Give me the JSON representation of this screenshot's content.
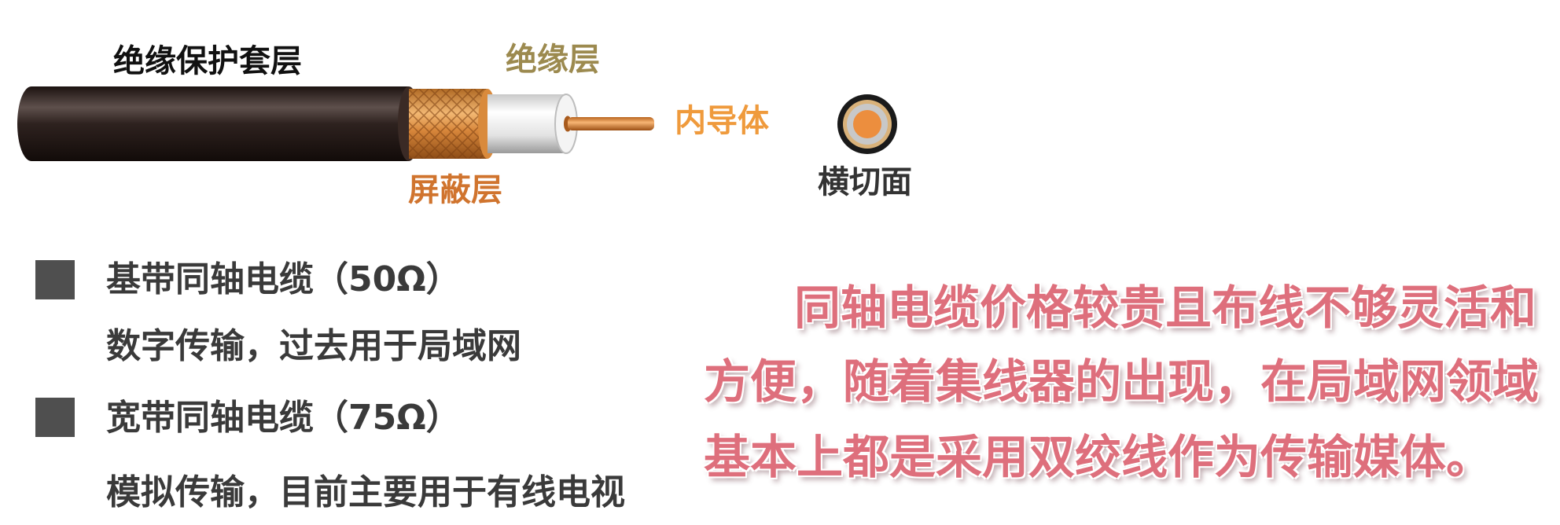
{
  "diagram": {
    "labels": {
      "jacket": "绝缘保护套层",
      "insulation": "绝缘层",
      "conductor": "内导体",
      "shield": "屏蔽层",
      "cross_section": "横切面"
    },
    "colors": {
      "jacket": "#2b1d19",
      "insulation_label": "#9c8a4f",
      "conductor_label": "#ef9a3c",
      "shield_label": "#d0742e",
      "cross_section_label": "#333333"
    }
  },
  "list": {
    "items": [
      {
        "title": "基带同轴电缆（50Ω）",
        "desc": "数字传输，过去用于局域网"
      },
      {
        "title": "宽带同轴电缆（75Ω）",
        "desc": "模拟传输，目前主要用于有线电视"
      }
    ]
  },
  "note": {
    "lines": [
      "同轴电缆价格较贵且布线不够灵活和",
      "方便，随着集线器的出现，在局域网领域",
      "基本上都是采用双绞线作为传输媒体。"
    ],
    "color": "#de6f7c"
  }
}
